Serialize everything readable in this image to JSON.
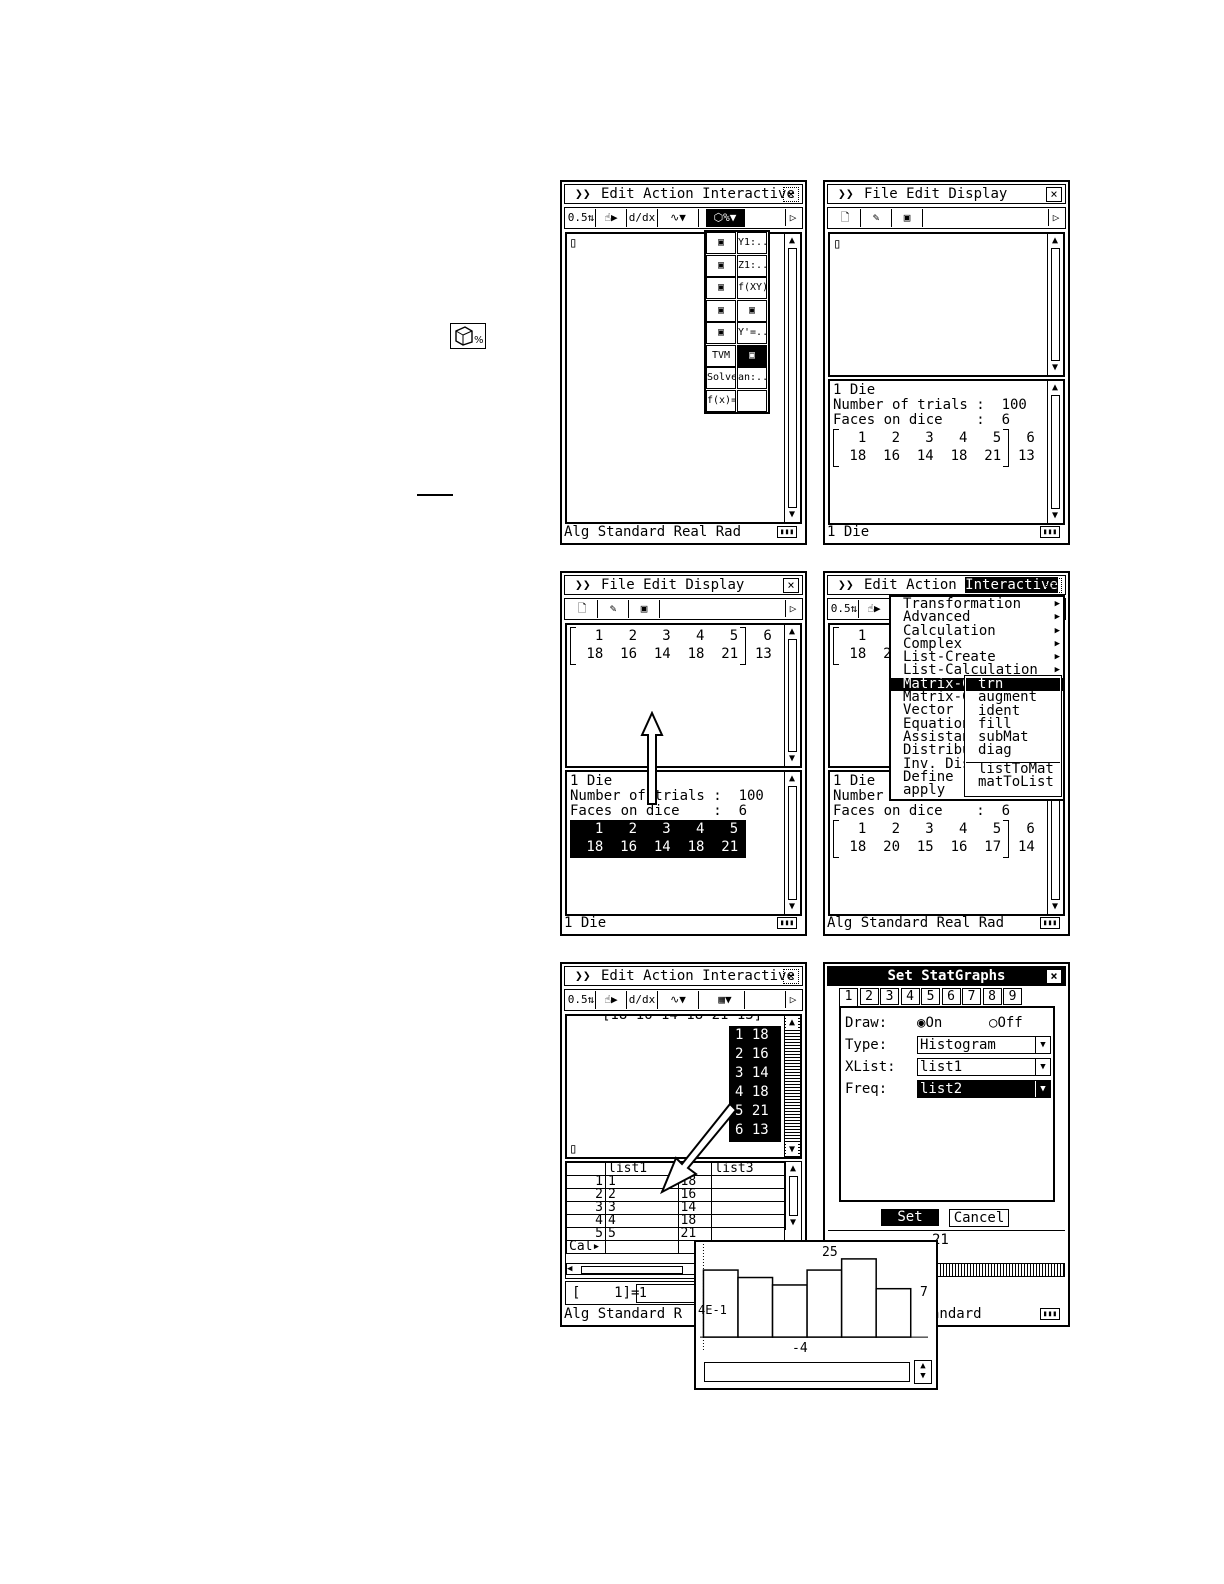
{
  "left_icon": "dice-percent-icon",
  "screen1": {
    "menu": [
      "Edit",
      "Action",
      "Interactive"
    ],
    "cursor": "▯",
    "palette": [
      [
        "graph-icon",
        "Y1:...Y2:..."
      ],
      [
        "3D-graph-icon",
        "Z1:...Z2:..."
      ],
      [
        "conics-icon",
        "f(XY)"
      ],
      [
        "geometry-icon",
        "table-icon"
      ],
      [
        "spreadsheet-icon",
        "Y'=..."
      ],
      [
        "TVM",
        "dice-percent-icon"
      ],
      [
        "Solve",
        "an:...bn:..."
      ],
      [
        "f(x)=",
        ""
      ]
    ],
    "status": "Alg    Standard Real Rad"
  },
  "screen2": {
    "menu": [
      "File",
      "Edit",
      "Display"
    ],
    "cursor": "▯",
    "lines": [
      "1 Die",
      "Number of trials :  100",
      "Faces on dice    :  6"
    ],
    "matrix": [
      [
        "1",
        "2",
        "3",
        "4",
        "5",
        "6"
      ],
      [
        "18",
        "16",
        "14",
        "18",
        "21",
        "13"
      ]
    ],
    "status": "1 Die"
  },
  "screen3": {
    "menu": [
      "File",
      "Edit",
      "Display"
    ],
    "top_matrix": [
      [
        "1",
        "2",
        "3",
        "4",
        "5",
        "6"
      ],
      [
        "18",
        "16",
        "14",
        "18",
        "21",
        "13"
      ]
    ],
    "lines": [
      "1 Die",
      "Number of trials :  100",
      "Faces on dice    :  6"
    ],
    "matrix": [
      [
        "1",
        "2",
        "3",
        "4",
        "5",
        "6"
      ],
      [
        "18",
        "16",
        "14",
        "18",
        "21",
        "13"
      ]
    ],
    "status": "1 Die"
  },
  "screen4": {
    "menu": [
      "Edit",
      "Action",
      "Interactive"
    ],
    "top_partial": [
      [
        "1",
        "2"
      ],
      [
        "18",
        "20"
      ]
    ],
    "interactive_menu": [
      "Transformation",
      "Advanced",
      "Calculation",
      "Complex",
      "List-Create",
      "List-Calculation",
      "Matrix-C",
      "Matrix-C",
      "Vector",
      "Equation",
      "Assistan",
      "Distribut",
      "Inv. Dis",
      "Define",
      "apply"
    ],
    "submenu": [
      "trn",
      "augment",
      "ident",
      "fill",
      "subMat",
      "diag",
      "listToMat",
      "matToList"
    ],
    "lines": [
      "1 Die",
      "Number",
      "Faces on dice    :  6"
    ],
    "matrix": [
      [
        "1",
        "2",
        "3",
        "4",
        "5",
        "6"
      ],
      [
        "18",
        "20",
        "15",
        "16",
        "17",
        "14"
      ]
    ],
    "status": "Alg    Standard Real Rad"
  },
  "screen5": {
    "menu": [
      "Edit",
      "Action",
      "Interactive"
    ],
    "top_partial_row": "[18 16 14 18 21 13]",
    "col_matrix": [
      [
        "1",
        "18"
      ],
      [
        "2",
        "16"
      ],
      [
        "3",
        "14"
      ],
      [
        "4",
        "18"
      ],
      [
        "5",
        "21"
      ],
      [
        "6",
        "13"
      ]
    ],
    "cursor": "▯",
    "sheet_headers": [
      "list1",
      "2",
      "list3"
    ],
    "sheet_rows": [
      [
        "1",
        "1",
        "18",
        ""
      ],
      [
        "2",
        "2",
        "16",
        ""
      ],
      [
        "3",
        "3",
        "14",
        ""
      ],
      [
        "4",
        "4",
        "18",
        ""
      ],
      [
        "5",
        "5",
        "21",
        ""
      ]
    ],
    "cal_label": "Cal▸",
    "cell_ref": "[    1]=",
    "cell_value": "1",
    "status": "Alg    Standard R"
  },
  "screen6": {
    "dialog_title": "Set StatGraphs",
    "tabs": [
      "1",
      "2",
      "3",
      "4",
      "5",
      "6",
      "7",
      "8",
      "9"
    ],
    "draw_label": "Draw:",
    "draw_on": "On",
    "draw_off": "Off",
    "type_label": "Type:",
    "type_value": "Histogram",
    "xlist_label": "XList:",
    "xlist_value": "list1",
    "freq_label": "Freq:",
    "freq_value": "list2",
    "set_button": "Set",
    "cancel_button": "Cancel",
    "behind_row": "21",
    "status": "andard"
  },
  "histogram": {
    "top_label": "25",
    "left_label": "4E-1",
    "right_label": "7",
    "bottom_label": "-4"
  },
  "chart_data": {
    "type": "bar",
    "categories": [
      "1",
      "2",
      "3",
      "4",
      "5",
      "6"
    ],
    "values": [
      18,
      16,
      14,
      18,
      21,
      13
    ],
    "title": "",
    "xlabel": "",
    "ylabel": "",
    "ylim": [
      -4,
      25
    ],
    "xlim": [
      0.4,
      7
    ]
  }
}
